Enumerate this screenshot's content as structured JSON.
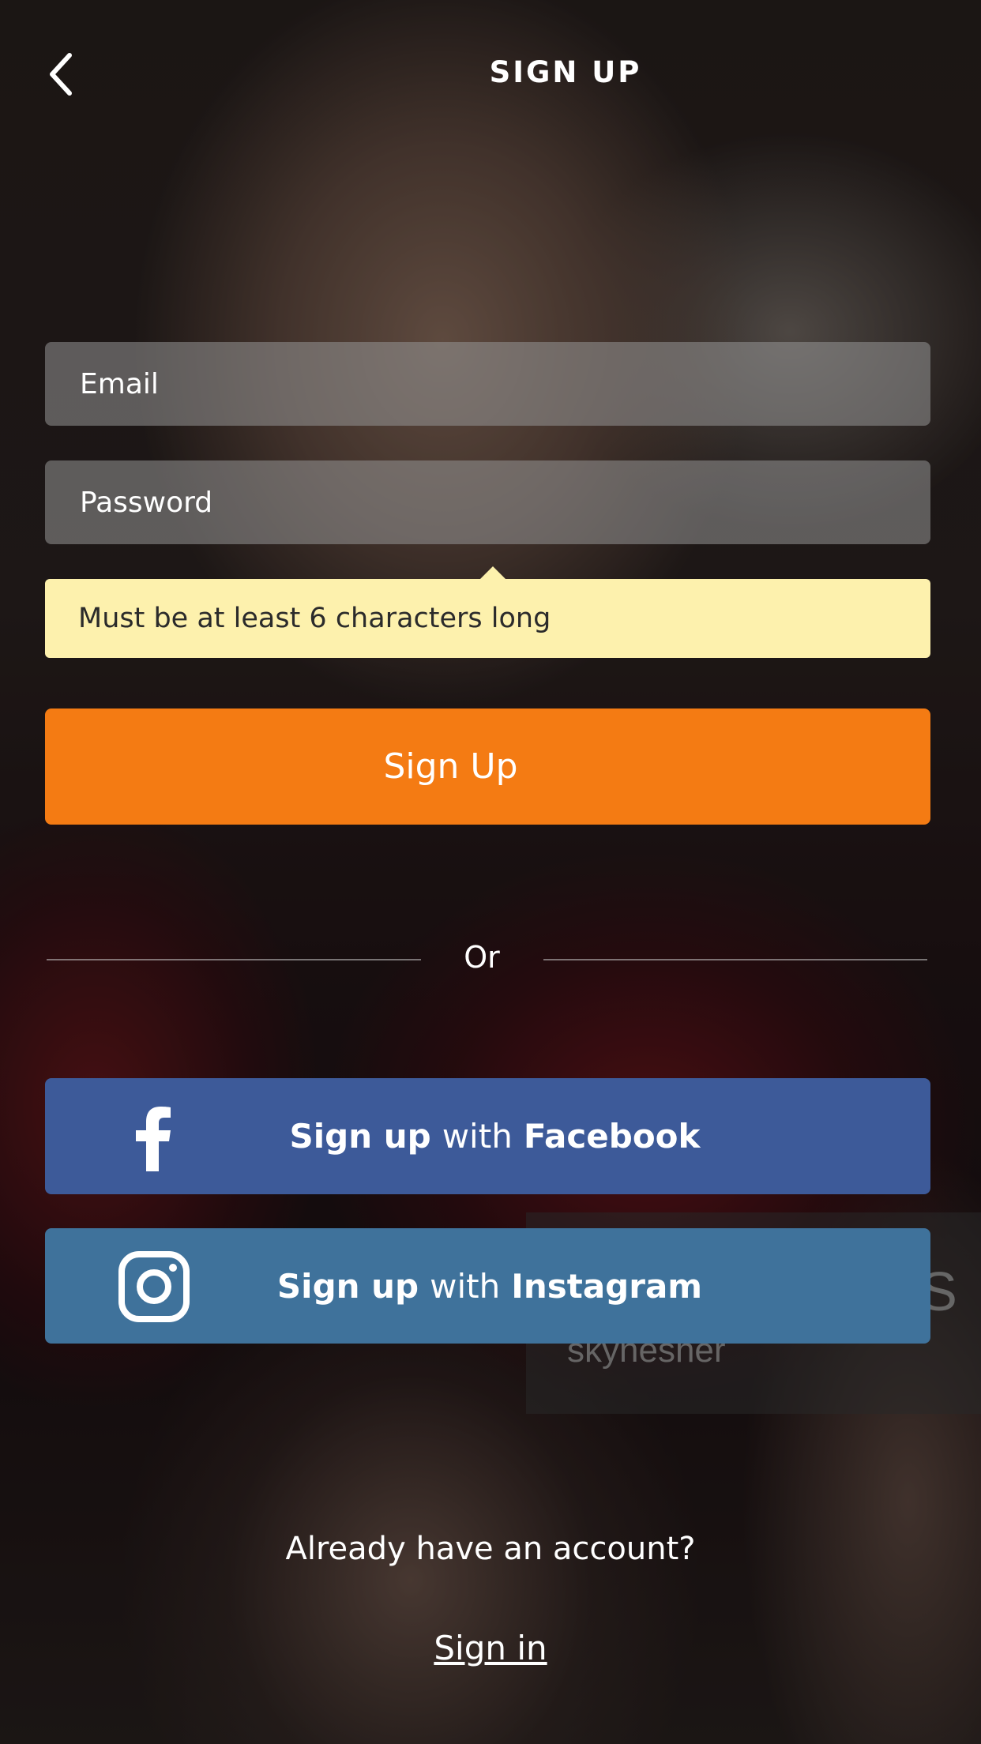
{
  "header": {
    "title": "SIGN UP",
    "back_icon": "chevron-left-icon"
  },
  "form": {
    "email_placeholder": "Email",
    "password_placeholder": "Password",
    "password_hint": "Must be at least 6 characters long",
    "signup_label": "Sign Up"
  },
  "divider": {
    "label": "Or"
  },
  "social": {
    "facebook": {
      "icon": "facebook-icon",
      "prefix": "Sign up",
      "middle": "with",
      "provider": "Facebook",
      "color": "#3d5a99"
    },
    "instagram": {
      "icon": "instagram-icon",
      "prefix": "Sign up",
      "middle": "with",
      "provider": "Instagram",
      "color": "#3f729b"
    }
  },
  "footer": {
    "already_text": "Already have an account?",
    "signin_label": "Sign in"
  },
  "watermark": {
    "text": "skynesher",
    "letter": "S"
  },
  "colors": {
    "accent": "#f47b13",
    "hint_bg": "#fdf1ad"
  }
}
